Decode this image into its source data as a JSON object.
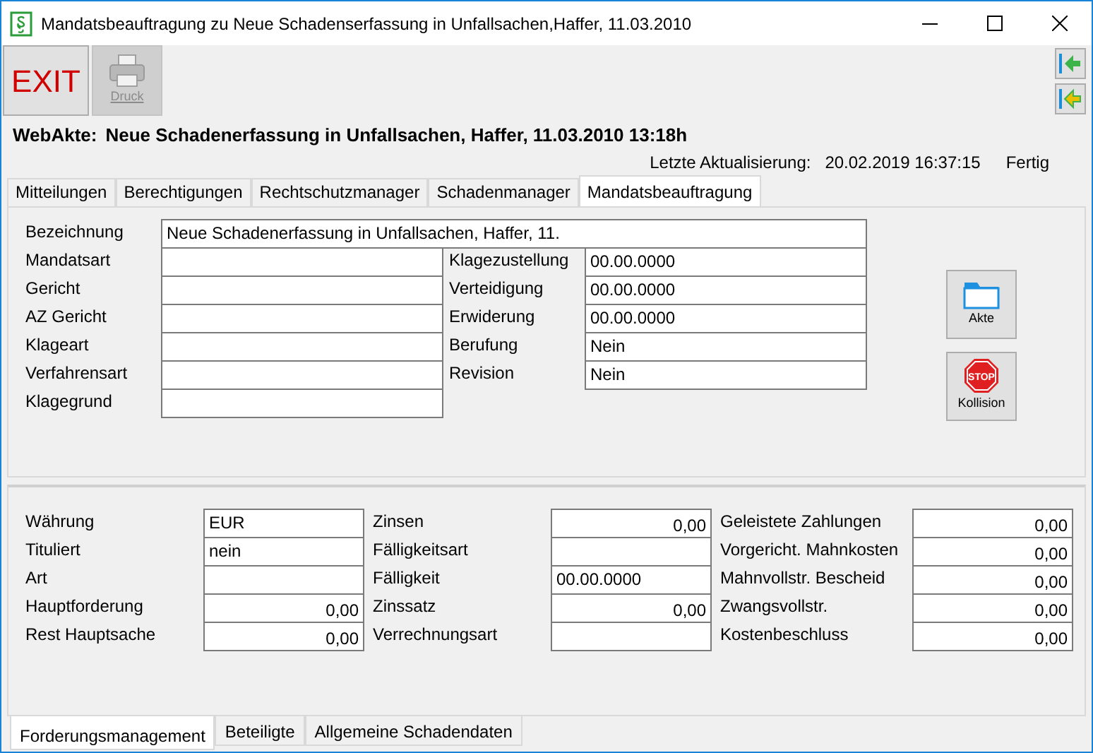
{
  "window": {
    "title": "Mandatsbeauftragung zu Neue Schadenserfassung in Unfallsachen,Haffer, 11.03.2010"
  },
  "toolbar": {
    "buttons": [
      {
        "kind": "exit",
        "label": "EXIT",
        "disabled": false
      },
      {
        "kind": "print",
        "label": "Druck",
        "disabled": true
      }
    ]
  },
  "header": {
    "label": "WebAkte:",
    "title": "Neue Schadenerfassung in Unfallsachen, Haffer, 11.03.2010 13:18h",
    "update_label": "Letzte Aktualisierung:",
    "update_time": "20.02.2019 16:37:15",
    "status": "Fertig"
  },
  "tabs": [
    {
      "label": "Mitteilungen",
      "selected": false
    },
    {
      "label": "Berechtigungen",
      "selected": false
    },
    {
      "label": "Rechtschutzmanager",
      "selected": false
    },
    {
      "label": "Schadenmanager",
      "selected": false
    },
    {
      "label": "Mandatsbeauftragung",
      "selected": true
    }
  ],
  "form": {
    "bezeichnung": {
      "label": "Bezeichnung",
      "value": "Neue Schadenerfassung in Unfallsachen, Haffer, 11."
    },
    "left": [
      {
        "label": "Mandatsart"
      },
      {
        "label": "Gericht"
      },
      {
        "label": "AZ Gericht"
      },
      {
        "label": "Klageart"
      },
      {
        "label": "Verfahrensart"
      },
      {
        "label": "Klagegrund"
      }
    ],
    "right": [
      {
        "label": "Klagezustellung",
        "value": "00.00.0000"
      },
      {
        "label": "Verteidigung",
        "value": "00.00.0000"
      },
      {
        "label": "Erwiderung",
        "value": "00.00.0000"
      },
      {
        "label": "Berufung",
        "value": "Nein"
      },
      {
        "label": "Revision",
        "value": "Nein"
      }
    ]
  },
  "side_buttons": [
    {
      "kind": "folder",
      "label": "Akte"
    },
    {
      "kind": "stop",
      "label": "Kollision",
      "icon_text": "STOP"
    }
  ],
  "finance": [
    [
      {
        "label": "Währung",
        "value": "EUR",
        "kind": "text"
      },
      {
        "label": "Tituliert",
        "value": "nein",
        "kind": "text"
      },
      {
        "label": "Art",
        "kind": "text"
      },
      {
        "label": "Hauptforderung",
        "value": "0,00",
        "kind": "amount"
      },
      {
        "label": "Rest Hauptsache",
        "value": "0,00",
        "kind": "amount"
      }
    ],
    [
      {
        "label": "Zinsen",
        "value": "0,00",
        "kind": "amount"
      },
      {
        "label": "Fälligkeitsart",
        "kind": "text"
      },
      {
        "label": "Fälligkeit",
        "value": "00.00.0000",
        "kind": "text"
      },
      {
        "label": "Zinssatz",
        "value": "0,00",
        "kind": "amount"
      },
      {
        "label": "Verrechnungsart",
        "kind": "text"
      }
    ],
    [
      {
        "label": "Geleistete Zahlungen",
        "value": "0,00",
        "kind": "amount"
      },
      {
        "label": "Vorgericht. Mahnkosten",
        "value": "0,00",
        "kind": "amount"
      },
      {
        "label": "Mahnvollstr. Bescheid",
        "value": "0,00",
        "kind": "amount"
      },
      {
        "label": "Zwangsvollstr.",
        "value": "0,00",
        "kind": "amount"
      },
      {
        "label": "Kostenbeschluss",
        "value": "0,00",
        "kind": "amount"
      }
    ]
  ],
  "bottom_tabs": [
    {
      "label": "Forderungsmanagement",
      "selected": true
    },
    {
      "label": "Beteiligte",
      "selected": false
    },
    {
      "label": "Allgemeine Schadendaten",
      "selected": false
    }
  ]
}
